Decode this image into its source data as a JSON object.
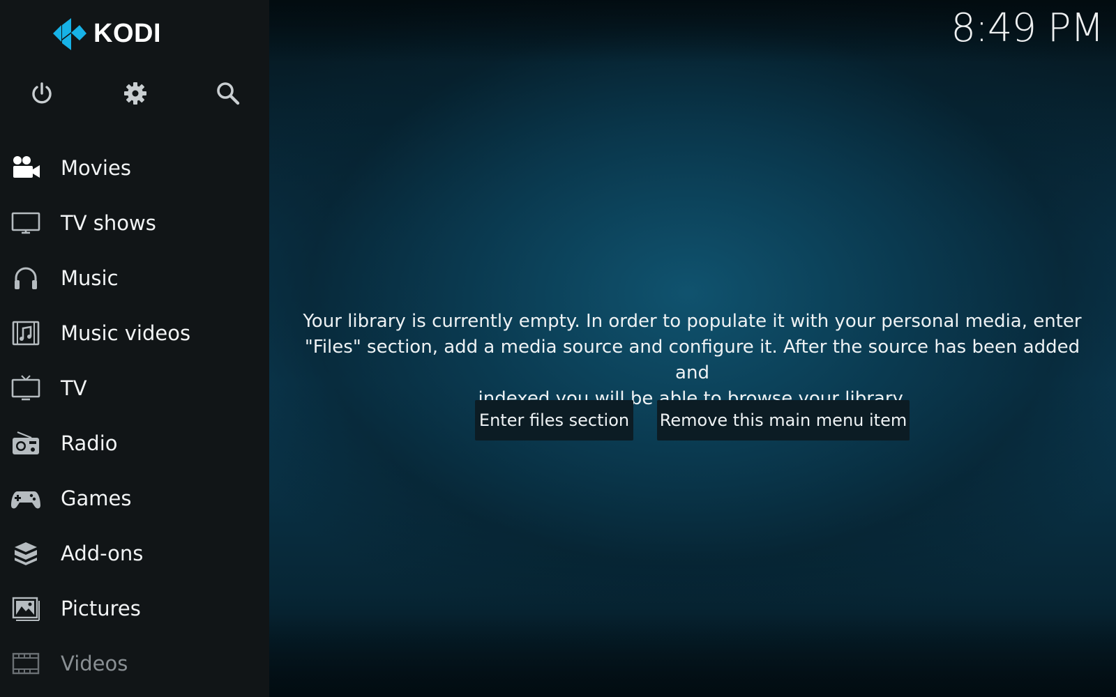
{
  "app": {
    "logo_text": "KODI",
    "clock": "8:49 PM"
  },
  "top_icons": [
    {
      "name": "power-icon"
    },
    {
      "name": "settings-icon"
    },
    {
      "name": "search-icon"
    }
  ],
  "menu": {
    "items": [
      {
        "label": "Movies",
        "icon": "movies-icon"
      },
      {
        "label": "TV shows",
        "icon": "tv-shows-icon"
      },
      {
        "label": "Music",
        "icon": "music-icon"
      },
      {
        "label": "Music videos",
        "icon": "music-videos-icon"
      },
      {
        "label": "TV",
        "icon": "tv-icon"
      },
      {
        "label": "Radio",
        "icon": "radio-icon"
      },
      {
        "label": "Games",
        "icon": "games-icon"
      },
      {
        "label": "Add-ons",
        "icon": "addons-icon"
      },
      {
        "label": "Pictures",
        "icon": "pictures-icon"
      },
      {
        "label": "Videos",
        "icon": "videos-icon"
      }
    ]
  },
  "main": {
    "message_line1": "Your library is currently empty. In order to populate it with your personal media, enter",
    "message_line2": "\"Files\" section, add a media source and configure it. After the source has been added and",
    "message_line3": "indexed you will be able to browse your library.",
    "enter_button": "Enter files section",
    "remove_button": "Remove this main menu item"
  },
  "colors": {
    "accent": "#17b2e7",
    "sidebar_bg": "#111517",
    "button_bg": "#0c1c24"
  }
}
